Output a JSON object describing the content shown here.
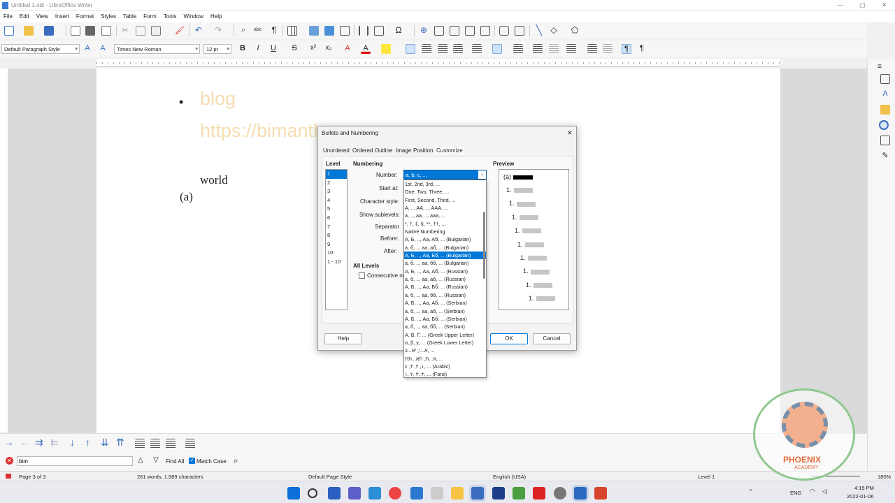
{
  "window": {
    "title": "Untitled 1.odt - LibreOffice Writer"
  },
  "menu": [
    "File",
    "Edit",
    "View",
    "Insert",
    "Format",
    "Styles",
    "Table",
    "Form",
    "Tools",
    "Window",
    "Help"
  ],
  "formatting": {
    "paragraph_style": "Default Paragraph Style",
    "font_name": "Times New Roman",
    "font_size": "12 pt"
  },
  "document": {
    "bullet": "•",
    "line1": "blog",
    "line2": "https://bimanthr...",
    "line3": "world",
    "line4": "(a)"
  },
  "dialog": {
    "title": "Bullets and Numbering",
    "tabs": [
      "Unordered",
      "Ordered",
      "Outline",
      "Image",
      "Position",
      "Customize"
    ],
    "level_header": "Level",
    "levels": [
      "1",
      "2",
      "3",
      "4",
      "5",
      "6",
      "7",
      "8",
      "9",
      "10",
      "1 - 10"
    ],
    "numbering_header": "Numbering",
    "number_label": "Number:",
    "number_value": "a, b, c, ...",
    "start_at_label": "Start at:",
    "char_style_label": "Character style:",
    "show_sublevels_label": "Show sublevels:",
    "separator_label": "Separator",
    "before_label": "Before:",
    "after_label": "After:",
    "all_levels_header": "All Levels",
    "consecutive_label": "Consecutive nu",
    "preview_header": "Preview",
    "preview_first": "(a)",
    "preview_items": [
      "1.",
      "1.",
      "1.",
      "1.",
      "1.",
      "1.",
      "1.",
      "1.",
      "1."
    ],
    "buttons": {
      "help": "Help",
      "ok": "OK",
      "cancel": "Cancel"
    }
  },
  "number_dropdown": {
    "selected_index": 9,
    "options": [
      "1st, 2nd, 3rd, ...",
      "One, Two, Three, ...",
      "First, Second, Third, ...",
      "A, .., AA, .., AAA, ...",
      "a, .., aa, .., aaa, ...",
      "*, †, ‡, §, **, ††, ...",
      "Native Numbering",
      "А, Б, .., Аа, Аб, ... (Bulgarian)",
      "а, б, .., аа, аб, ... (Bulgarian)",
      "А, Б, .., Аа, Бб, ... (Bulgarian)",
      "а, б, .., аа, бб, ... (Bulgarian)",
      "А, Б, .., Аа, Аб, ... (Russian)",
      "а, б, .., аа, аб, ... (Russian)",
      "А, Б, .., Аа, Бб, ... (Russian)",
      "а, б, .., аа, бб, ... (Russian)",
      "А, Б, .., Аа, Аб, ... (Serbian)",
      "а, б, .., аа, аб, ... (Serbian)",
      "А, Б, .., Аа, Бб, ... (Serbian)",
      "а, б, .., аа, бб, ... (Serbian)",
      "Α, Β, Γ, ... (Greek Upper Letter)",
      "α, β, γ, ... (Greek Lower Letter)",
      "א...י, יא...כ, ...",
      "א...ת, תא...תת, ...",
      "١, ٢, ٣, ٤, ... (Arabic)",
      "۱, ۲, ۳, ۴, ... (Farsi)"
    ]
  },
  "findbar": {
    "search_value": "bim",
    "find_all": "Find All",
    "match_case": "Match Case"
  },
  "status": {
    "page": "Page 3 of 3",
    "words": "261 words, 1,989 characters",
    "page_style": "Default Page Style",
    "language": "English (USA)",
    "level": "Level 1",
    "zoom": "180%"
  },
  "taskbar": {
    "lang": "ENG",
    "time": "4:15 PM",
    "date": "2022-01-06"
  },
  "watermark": {
    "text": "PHOENIX",
    "sub": "ACADEMY"
  },
  "colors": {
    "accent": "#0078d7",
    "doc_faded": "#f5ddb0",
    "watermark_ring": "#8fc98f",
    "watermark_text": "#e36a3a"
  }
}
